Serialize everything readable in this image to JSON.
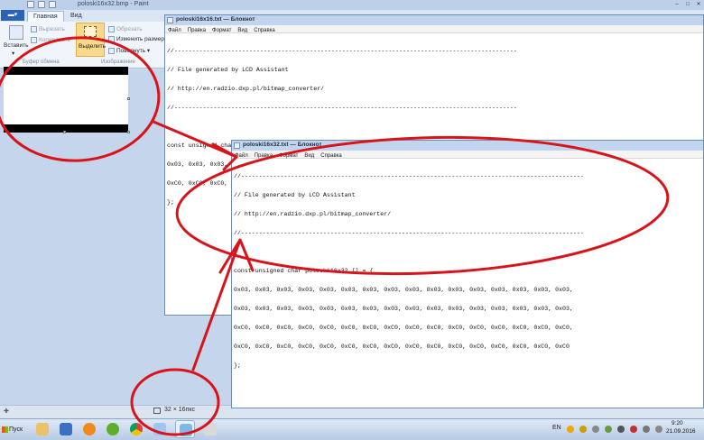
{
  "paint": {
    "title": "poloski16x32.bmp - Paint",
    "file_menu_label": "",
    "tabs": [
      "Главная",
      "Вид"
    ],
    "ribbon": {
      "paste_label": "Вставить",
      "cut_label": "Вырезать",
      "copy_label": "Копировать",
      "select_label": "Выделить",
      "crop_label": "Обрезать",
      "resize_label": "Изменить размер",
      "rotate_label": "Повернуть",
      "clipboard_group": "Буфер обмена",
      "image_group": "Изображение"
    },
    "status": {
      "dimensions": "32 × 16пкс"
    }
  },
  "notepad_back": {
    "title": "poloski16x16.txt — Блокнот",
    "menu": [
      "Файл",
      "Правка",
      "Формат",
      "Вид",
      "Справка"
    ],
    "lines": [
      "//------------------------------------------------------------------------------------------------",
      "// File generated by LCD Assistant",
      "// http://en.radzio.dxp.pl/bitmap_converter/",
      "//------------------------------------------------------------------------------------------------",
      "",
      "const unsigned char poloski16x16 [] = {",
      "0x03, 0x03, 0x03, 0x03, 0x03, 0x03, 0x03, 0x03, 0x03, 0x03, 0x03, 0x03, 0x03, 0x03, 0x03, 0x03,",
      "0xC0, 0xC0, 0xC0, 0xC0, 0xC0, 0xC0, 0xC0, 0xC0, 0xC0, 0xC0, 0xC0, 0xC0, 0xC0, 0xC0, 0xC0, 0xC0",
      "};"
    ]
  },
  "notepad_front": {
    "title": "poloski16x32.txt — Блокнот",
    "menu": [
      "Файл",
      "Правка",
      "Формат",
      "Вид",
      "Справка"
    ],
    "lines": [
      "//------------------------------------------------------------------------------------------------",
      "// File generated by LCD Assistant",
      "// http://en.radzio.dxp.pl/bitmap_converter/",
      "//------------------------------------------------------------------------------------------------",
      "",
      "const unsigned char poloski16x32 [] = {",
      "0x03, 0x03, 0x03, 0x03, 0x03, 0x03, 0x03, 0x03, 0x03, 0x03, 0x03, 0x03, 0x03, 0x03, 0x03, 0x03,",
      "0x03, 0x03, 0x03, 0x03, 0x03, 0x03, 0x03, 0x03, 0x03, 0x03, 0x03, 0x03, 0x03, 0x03, 0x03, 0x03,",
      "0xC0, 0xC0, 0xC0, 0xC0, 0xC0, 0xC0, 0xC0, 0xC0, 0xC0, 0xC0, 0xC0, 0xC0, 0xC0, 0xC0, 0xC0, 0xC0,",
      "0xC0, 0xC0, 0xC0, 0xC0, 0xC0, 0xC0, 0xC0, 0xC0, 0xC0, 0xC0, 0xC0, 0xC0, 0xC0, 0xC0, 0xC0, 0xC0",
      "};"
    ]
  },
  "taskbar": {
    "start_label": "Пуск",
    "apps": [
      "explorer-icon",
      "media-player-icon",
      "vlc-icon",
      "utorrent-icon",
      "chrome-icon",
      "paint-icon",
      "notepad-icon",
      "paint-app-icon"
    ],
    "language": "EN",
    "time": "9:20",
    "date": "21.09.2016"
  },
  "colors": {
    "annotation_red": "#d8141a",
    "title_active": "#c2d5ee",
    "select_highlight": "#fbd98a"
  }
}
